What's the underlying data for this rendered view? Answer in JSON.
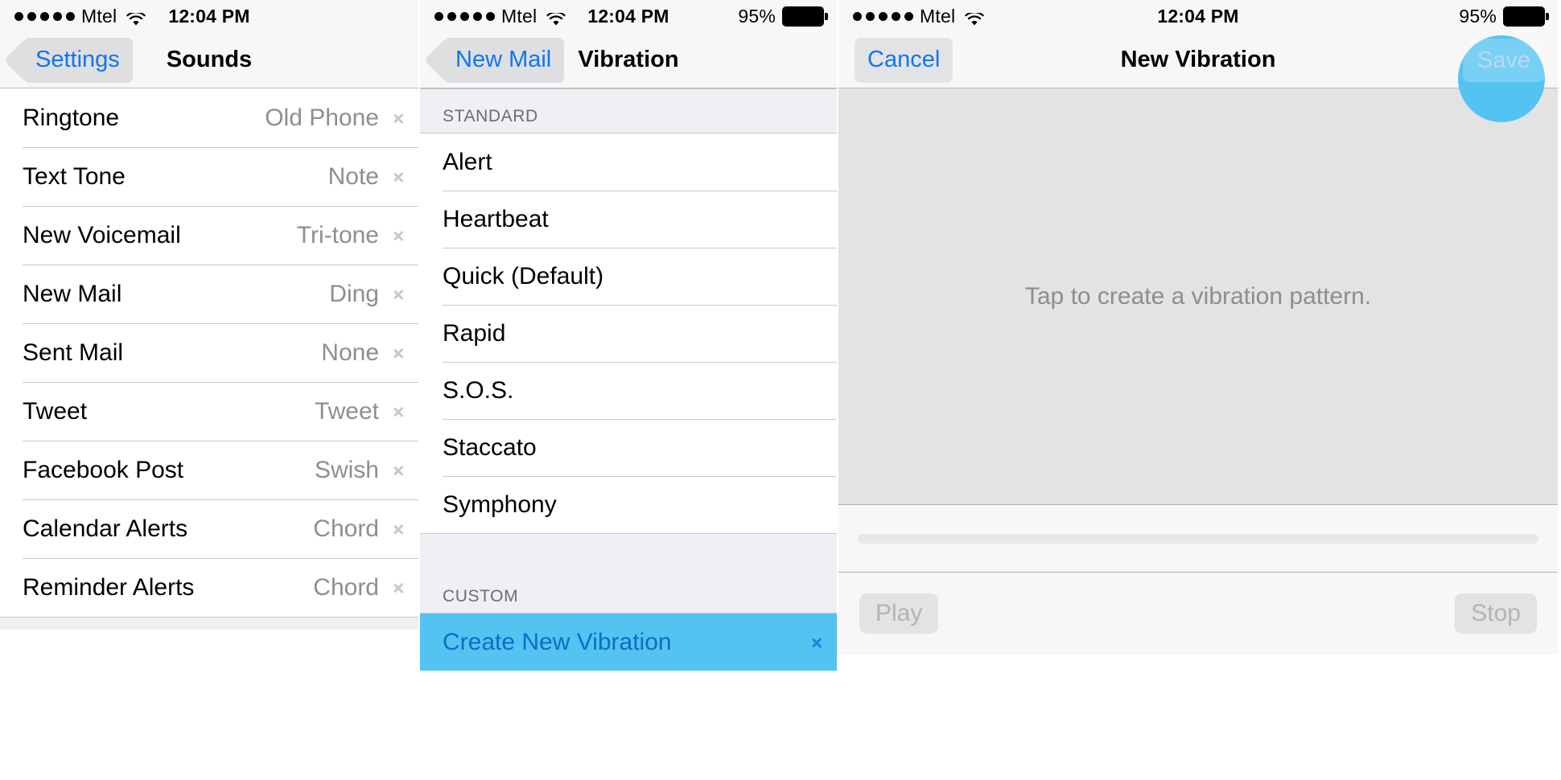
{
  "status_bar": {
    "signal_dots": 5,
    "carrier": "Mtel",
    "wifi_icon": "wifi-icon",
    "time": "12:04 PM",
    "battery_percent": "95%",
    "battery_icon": "battery-full-icon"
  },
  "colors": {
    "accent_blue": "#0c76f4",
    "tap_highlight": "#54c3f1",
    "selected_row": "#54c3f1",
    "section_bg": "#efeff4",
    "separator": "#c8c7cc",
    "nav_bg": "#f7f7f7",
    "record_area_bg": "#e3e3e3",
    "value_gray": "#8e8e93"
  },
  "panel1": {
    "nav": {
      "back_label": "Settings",
      "title": "Sounds"
    },
    "rows": [
      {
        "label": "Ringtone",
        "value": "Old Phone"
      },
      {
        "label": "Text Tone",
        "value": "Note"
      },
      {
        "label": "New Voicemail",
        "value": "Tri-tone"
      },
      {
        "label": "New Mail",
        "value": "Ding"
      },
      {
        "label": "Sent Mail",
        "value": "None"
      },
      {
        "label": "Tweet",
        "value": "Tweet"
      },
      {
        "label": "Facebook Post",
        "value": "Swish"
      },
      {
        "label": "Calendar Alerts",
        "value": "Chord"
      },
      {
        "label": "Reminder Alerts",
        "value": "Chord"
      }
    ]
  },
  "panel2": {
    "nav": {
      "back_label": "New Mail",
      "title": "Vibration"
    },
    "section_standard": "STANDARD",
    "standard_rows": [
      {
        "label": "Alert"
      },
      {
        "label": "Heartbeat"
      },
      {
        "label": "Quick (Default)"
      },
      {
        "label": "Rapid"
      },
      {
        "label": "S.O.S."
      },
      {
        "label": "Staccato"
      },
      {
        "label": "Symphony"
      }
    ],
    "section_custom": "CUSTOM",
    "custom_rows": [
      {
        "label": "Create New Vibration",
        "selected": true
      }
    ]
  },
  "panel3": {
    "nav": {
      "cancel_label": "Cancel",
      "title": "New Vibration",
      "save_label": "Save",
      "save_disabled": true
    },
    "record_hint": "Tap to create a vibration pattern.",
    "transport": {
      "play_label": "Play",
      "stop_label": "Stop"
    }
  }
}
